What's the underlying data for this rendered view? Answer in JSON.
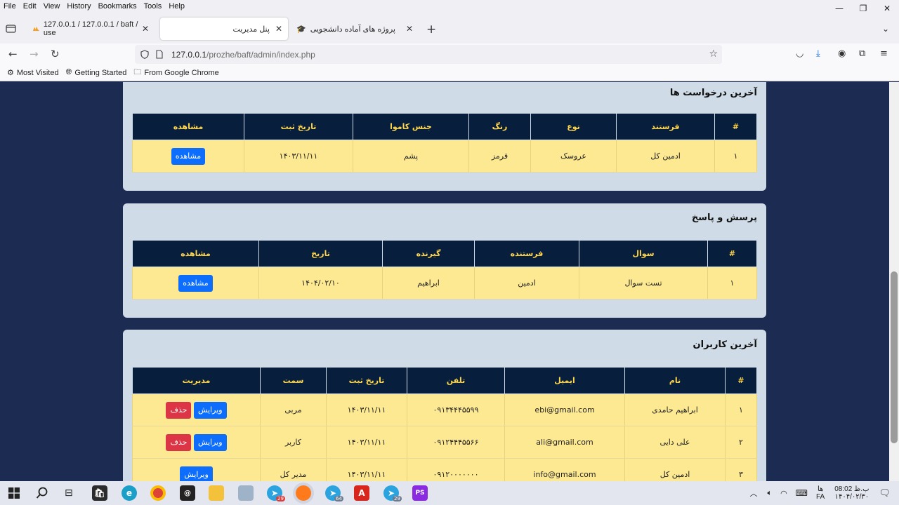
{
  "menubar": {
    "items": [
      "File",
      "Edit",
      "View",
      "History",
      "Bookmarks",
      "Tools",
      "Help"
    ]
  },
  "window": {
    "minimize": "—",
    "maximize": "❐",
    "close": "✕"
  },
  "tabs": [
    {
      "title": "127.0.0.1 / 127.0.0.1 / baft / use"
    },
    {
      "title": "پنل مدیریت"
    },
    {
      "title": "پروژه های آماده دانشجویی"
    }
  ],
  "navbar": {
    "url_host": "127.0.0.1",
    "url_path": "/prozhe/baft/admin/index.php"
  },
  "bookmarks": [
    {
      "label": "Most Visited",
      "icon": "gear-icon"
    },
    {
      "label": "Getting Started",
      "icon": "globe-icon"
    },
    {
      "label": "From Google Chrome",
      "icon": "folder-icon"
    }
  ],
  "requests_card": {
    "title": "آخرین درخواست ها",
    "headers": [
      "#",
      "فرستند",
      "نوع",
      "رنگ",
      "جنس کاموا",
      "تاریخ ثبت",
      "مشاهده"
    ],
    "rows": [
      {
        "num": "۱",
        "sender": "ادمین کل",
        "type": "عروسک",
        "color": "قرمز",
        "material": "پشم",
        "date": "۱۴۰۳/۱۱/۱۱",
        "view": "مشاهده"
      }
    ]
  },
  "qa_card": {
    "title": "پرسش و پاسخ",
    "headers": [
      "#",
      "سوال",
      "فرستنده",
      "گیرنده",
      "تاریخ",
      "مشاهده"
    ],
    "rows": [
      {
        "num": "۱",
        "question": "تست سوال",
        "sender": "ادمین",
        "receiver": "ابراهیم",
        "date": "۱۴۰۴/۰۲/۱۰",
        "view": "مشاهده"
      }
    ]
  },
  "users_card": {
    "title": "آخرین کاربران",
    "headers": [
      "#",
      "نام",
      "ایمیل",
      "تلفن",
      "تاریخ ثبت",
      "سمت",
      "مدیریت"
    ],
    "edit_label": "ویرایش",
    "delete_label": "حذف",
    "rows": [
      {
        "num": "۱",
        "name": "ابراهیم حامدی",
        "email": "ebi@gmail.com",
        "phone": "۰۹۱۳۴۴۴۵۵۹۹",
        "date": "۱۴۰۳/۱۱/۱۱",
        "role": "مربی"
      },
      {
        "num": "۲",
        "name": "علی دایی",
        "email": "ali@gmail.com",
        "phone": "۰۹۱۲۴۴۴۵۵۶۶",
        "date": "۱۴۰۳/۱۱/۱۱",
        "role": "کاربر"
      },
      {
        "num": "۳",
        "name": "ادمین کل",
        "email": "info@gmail.com",
        "phone": "۰۹۱۲۰۰۰۰۰۰۰",
        "date": "۱۴۰۳/۱۱/۱۱",
        "role": "مدیر کل"
      }
    ]
  },
  "taskbar": {
    "telegram_badge_1": "29",
    "telegram_badge_2": "64",
    "telegram_badge_3": "29",
    "lang": "FA",
    "lang_top": "ها",
    "time": "ب.ظ 08:02",
    "date": "۱۴۰۴/۰۲/۳۰"
  },
  "colors": {
    "page_bg": "#1c2b52",
    "card_bg": "#cfdce8",
    "table_header_bg": "#071e3d",
    "table_header_text": "#ffd54a",
    "row_bg": "#fde992",
    "primary_button": "#0d6efd",
    "danger_button": "#dc3545"
  }
}
